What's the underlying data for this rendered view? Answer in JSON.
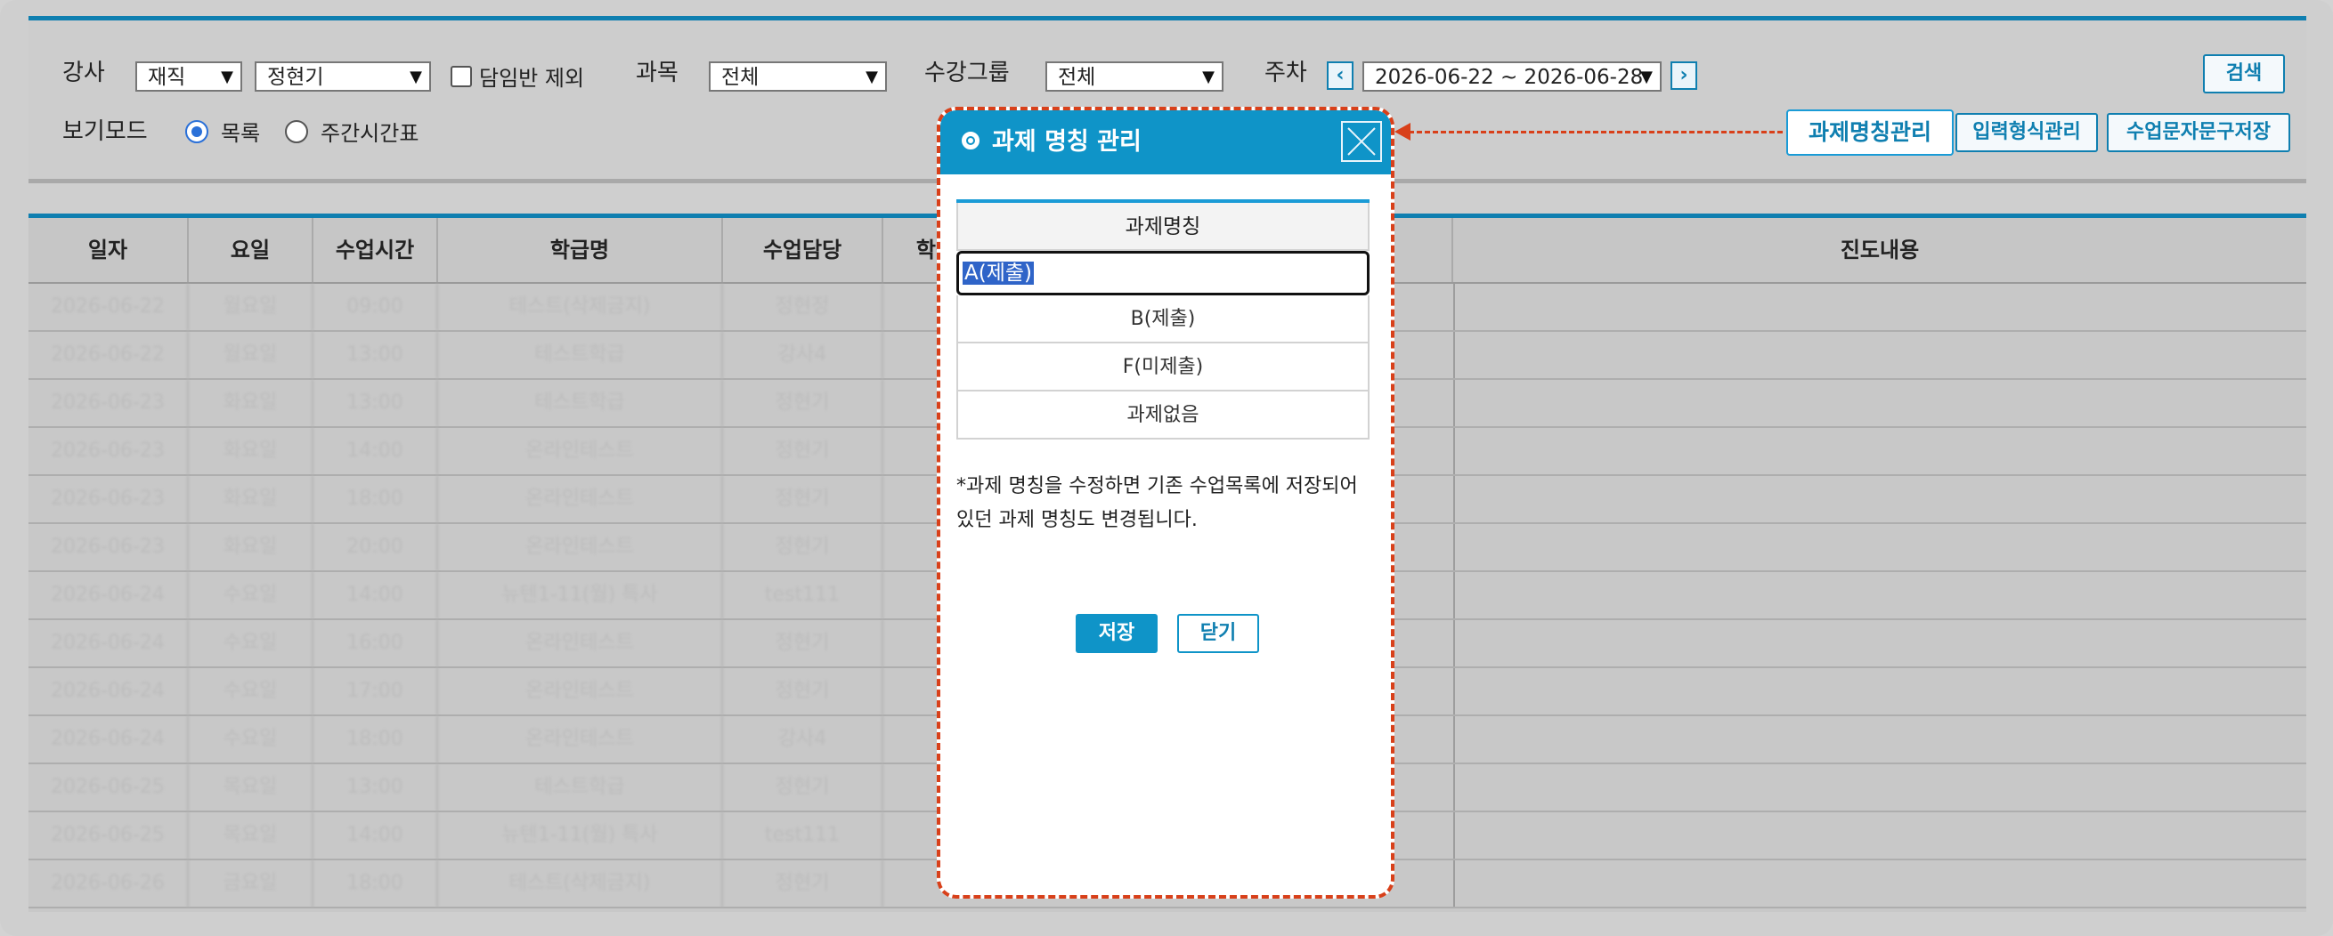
{
  "filters": {
    "teacher_label": "강사",
    "teacher_status": "재직",
    "teacher_name": "정현기",
    "exclude_homeroom_label": "담임반 제외",
    "subject_label": "과목",
    "subject_value": "전체",
    "group_label": "수강그룹",
    "group_value": "전체",
    "week_label": "주차",
    "week_value": "2026-06-22 ~ 2026-06-28",
    "search_label": "검색",
    "view_mode_label": "보기모드",
    "view_list_label": "목록",
    "view_weekly_label": "주간시간표"
  },
  "actions": {
    "assignment_name_manage": "과제명칭관리",
    "input_format_manage": "입력형식관리",
    "sms_phrase_save": "수업문자문구저장"
  },
  "table": {
    "headers": [
      "일자",
      "요일",
      "수업시간",
      "학급명",
      "수업담당",
      "학생",
      "진도내용"
    ],
    "rows": [
      [
        "2026-06-22",
        "월요일",
        "09:00",
        "테스트(삭제금지)",
        "정현정"
      ],
      [
        "2026-06-22",
        "월요일",
        "13:00",
        "테스트학급",
        "강사4"
      ],
      [
        "2026-06-23",
        "화요일",
        "13:00",
        "테스트학급",
        "정현기"
      ],
      [
        "2026-06-23",
        "화요일",
        "14:00",
        "온라인테스트",
        "정현기"
      ],
      [
        "2026-06-23",
        "화요일",
        "18:00",
        "온라인테스트",
        "정현기"
      ],
      [
        "2026-06-23",
        "화요일",
        "20:00",
        "온라인테스트",
        "정현기"
      ],
      [
        "2026-06-24",
        "수요일",
        "14:00",
        "뉴텐1-11(월) 특사",
        "test111"
      ],
      [
        "2026-06-24",
        "수요일",
        "16:00",
        "온라인테스트",
        "정현기"
      ],
      [
        "2026-06-24",
        "수요일",
        "17:00",
        "온라인테스트",
        "정현기"
      ],
      [
        "2026-06-24",
        "수요일",
        "18:00",
        "온라인테스트",
        "강사4"
      ],
      [
        "2026-06-25",
        "목요일",
        "13:00",
        "테스트학급",
        "정현기"
      ],
      [
        "2026-06-25",
        "목요일",
        "14:00",
        "뉴텐1-11(월) 특사",
        "test111"
      ],
      [
        "2026-06-26",
        "금요일",
        "18:00",
        "테스트(삭제금지)",
        "정현기"
      ]
    ]
  },
  "modal": {
    "title": "과제 명칭 관리",
    "column_header": "과제명칭",
    "items": {
      "editing": "A(제출)",
      "b": "B(제출)",
      "f": "F(미제출)",
      "none": "과제없음"
    },
    "notice": "*과제 명칭을 수정하면 기존 수업목록에 저장되어 있던 과제 명칭도 변경됩니다.",
    "save_label": "저장",
    "close_label": "닫기"
  },
  "colors": {
    "accent": "#0f94c8",
    "annotation": "#d8401a"
  }
}
